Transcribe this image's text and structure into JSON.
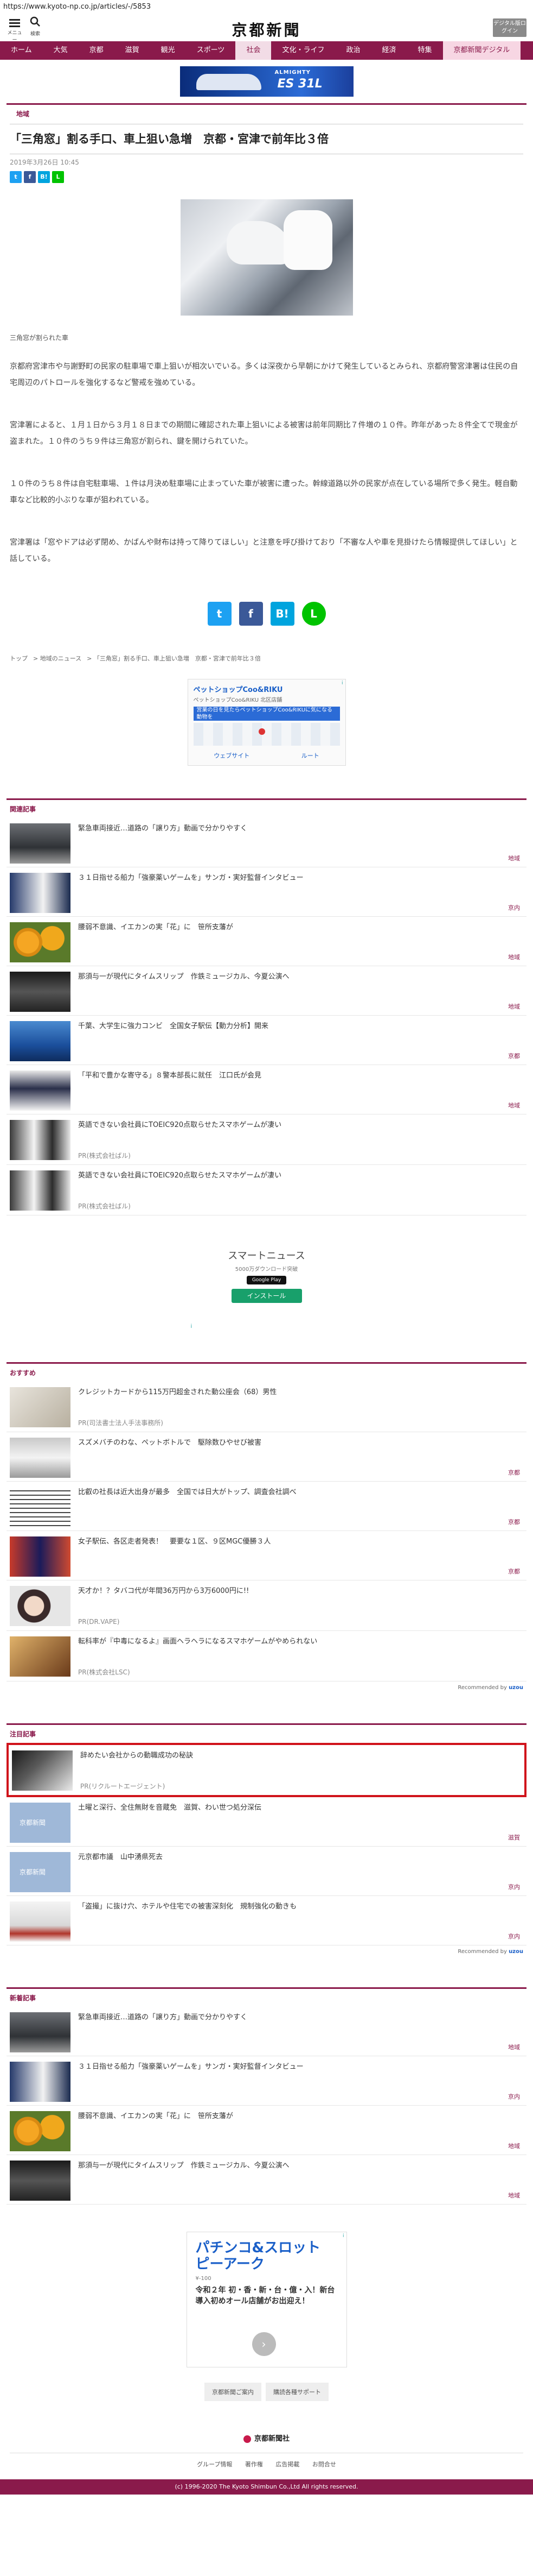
{
  "url": "https://www.kyoto-np.co.jp/articles/-/5853",
  "header": {
    "menu_label": "メニュー",
    "search_label": "検索",
    "logo": "京都新聞",
    "edition_label": "デジタル版ログイン"
  },
  "nav": [
    "ホーム",
    "大気",
    "京都",
    "滋賀",
    "観光",
    "スポーツ",
    "社会",
    "文化・ライフ",
    "政治",
    "経済",
    "特集",
    "京都新聞デジタル"
  ],
  "banner": {
    "title": "ALMIGHTY",
    "model": "ES 31L"
  },
  "article": {
    "category": "地域",
    "headline": "「三角窓」割る手口、車上狙い急増　京都・宮津で前年比３倍",
    "date": "2019年3月26日 10:45",
    "caption": "三角窓が割られた車",
    "paragraphs": [
      "京都府宮津市や与謝野町の民家の駐車場で車上狙いが相次いでいる。多くは深夜から早朝にかけて発生しているとみられ、京都府警宮津署は住民の自宅周辺のパトロールを強化するなど警戒を強めている。",
      "宮津署によると、１月１日から３月１８日までの期間に確認された車上狙いによる被害は前年同期比７件増の１０件。昨年があった８件全てで現金が盗まれた。１０件のうち９件は三角窓が割られ、鍵を開けられていた。",
      "１０件のうち８件は自宅駐車場、１件は月決め駐車場に止まっていた車が被害に遭った。幹線道路以外の民家が点在している場所で多く発生。軽自動車など比較的小ぶりな車が狙われている。",
      "宮津署は「窓やドアは必ず閉め、かばんや財布は持って降りてほしい」と注意を呼び掛けており「不審な人や車を見掛けたら情報提供してほしい」と話している。"
    ]
  },
  "share": {
    "twitter": "t",
    "facebook": "f",
    "hatena": "B!",
    "line": "L"
  },
  "breadcrumb": [
    "トップ",
    "地域のニュース",
    "「三角窓」割る手口、車上狙い急増　京都・宮津で前年比３倍"
  ],
  "map_ad": {
    "title": "ペットショップCoo&RIKU",
    "subtitle": "ペットショップCoo&RIKU 北区店舗",
    "blue_text": "営業の日を見たらペットショップCoo&RIKUに気になる動物を",
    "action_1": "ウェブサイト",
    "action_2": "ルート",
    "ad_tag": "i"
  },
  "related": {
    "heading": "関連記事",
    "items": [
      {
        "title": "緊急車両接近…道路の「譲り方」動画で分かりやすく",
        "tag": "地域"
      },
      {
        "title": "３１日指せる船力「強豪薬いゲームを」サンガ・実好監督インタビュー",
        "tag": "京内"
      },
      {
        "title": "腰弱不意識、イエカンの実「花」に　笹所支藩が",
        "tag": "地域"
      },
      {
        "title": "那須与一が現代にタイムスリップ　作鉄ミュージカル、今夏公演へ",
        "tag": "地域"
      },
      {
        "title": "千葉、大学生に強力コンビ　全国女子駅伝【動力分析】開来",
        "tag": "京都"
      },
      {
        "title": "「平和で豊かな寄守る」８警本部長に就任　江口氏が会見",
        "tag": "地域"
      },
      {
        "title": "英語できない会社員にTOEIC920点取らせたスマホゲームが凄い",
        "pr": "PR(株式会社ばル)"
      },
      {
        "title": "英語できない会社員にTOEIC920点取らせたスマホゲームが凄い",
        "pr": "PR(株式会社ばル)"
      }
    ]
  },
  "smart_ad": {
    "logo": "スマートニュース",
    "sub": "5000万ダウンロード突破",
    "store": "Google Play",
    "install": "インストール",
    "ad_tag": "i"
  },
  "recommend": {
    "heading": "おすすめ",
    "items": [
      {
        "title": "クレジットカードから115万円超金された動公座会（68）男性",
        "pr": "PR(司法書士法人手法事務所)"
      },
      {
        "title": "スズメバチのわな、ペットボトルで　駆除数ひやせび被害",
        "tag": "京都"
      },
      {
        "title": "比叡の社長は近大出身が最多　全国では日大がトップ、調査会社調べ",
        "tag": "京都"
      },
      {
        "title": "女子駅伝、各区走者発表！　要要な１区、９区MGC優勝３人",
        "tag": "京都"
      },
      {
        "title": "天才か！？タバコ代が年間36万円から3万6000円に!!",
        "pr": "PR(DR.VAPE)"
      },
      {
        "title": "転科率が『中毒になるよ』画面ヘラヘラになるスマホゲームがやめられない",
        "pr": "PR(株式会社LSC)"
      }
    ],
    "powered": "Recommended by",
    "powered_brand": "uzou"
  },
  "attention": {
    "heading": "注目記事",
    "items": [
      {
        "title": "辞めたい会社からの動職成功の秘訣",
        "pr": "PR(リクルートエージェント)"
      },
      {
        "title": "土曜と深行、全住無財を音蔵免　滋賀、わい世つ処分深伝",
        "tag": "滋賀"
      },
      {
        "title": "元京都市議　山中湧県死去",
        "tag": "京内"
      },
      {
        "title": "「盗撮」に抜け穴、ホテルや住宅での被害深刻化　規制強化の動きも",
        "tag": "京内"
      }
    ],
    "powered": "Recommended by",
    "powered_brand": "uzou"
  },
  "new": {
    "heading": "新着記事",
    "items": [
      {
        "title": "緊急車両接近…道路の「譲り方」動画で分かりやすく",
        "tag": "地域"
      },
      {
        "title": "３１日指せる船力「強豪薬いゲームを」サンガ・実好監督インタビュー",
        "tag": "京内"
      },
      {
        "title": "腰弱不意識、イエカンの実「花」に　笹所支藩が",
        "tag": "地域"
      },
      {
        "title": "那須与一が現代にタイムスリップ　作鉄ミュージカル、今夏公演へ",
        "tag": "地域"
      }
    ]
  },
  "footer_ad": {
    "title": "パチンコ&スロット ピーアーク",
    "price": "¥-100",
    "body": "令和２年 初・香・新・台・億・入！新台導入初めオール店舗がお出迎え！",
    "ad_tag": "i"
  },
  "footer": {
    "btn_1": "京都新聞ご案内",
    "btn_2": "購読各種サポート",
    "logo": "京都新聞社",
    "links": [
      "グループ情報",
      "著作権",
      "広告掲載",
      "お問合せ"
    ],
    "copyright": "(c) 1996-2020 The Kyoto Shimbun Co.,Ltd All rights reserved."
  },
  "colors": {
    "brand": "#8a1a4b",
    "highlight": "#d0131b",
    "link": "#1a5fc8"
  }
}
